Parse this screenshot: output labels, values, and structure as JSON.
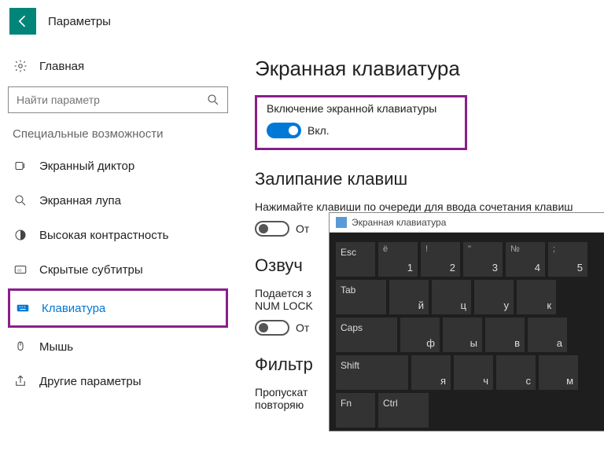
{
  "header": {
    "title": "Параметры"
  },
  "sidebar": {
    "home_label": "Главная",
    "search_placeholder": "Найти параметр",
    "section_header": "Специальные возможности",
    "items": [
      {
        "label": "Экранный диктор",
        "name": "nav-narrator"
      },
      {
        "label": "Экранная лупа",
        "name": "nav-magnifier"
      },
      {
        "label": "Высокая контрастность",
        "name": "nav-high-contrast"
      },
      {
        "label": "Скрытые субтитры",
        "name": "nav-closed-captions"
      },
      {
        "label": "Клавиатура",
        "name": "nav-keyboard"
      },
      {
        "label": "Мышь",
        "name": "nav-mouse"
      },
      {
        "label": "Другие параметры",
        "name": "nav-other-options"
      }
    ]
  },
  "main": {
    "h1": "Экранная клавиатура",
    "osk_setting": {
      "desc": "Включение экранной клавиатуры",
      "state_label": "Вкл."
    },
    "sticky": {
      "h2": "Залипание клавиш",
      "desc": "Нажимайте клавиши по очереди для ввода сочетания клавиш",
      "state_label": "Откл."
    },
    "toggle_snippet": "От",
    "sound": {
      "h2": "Озвучивание переключений",
      "desc": "Подается звуковой сигнал при нажатии клавиш CAPS LOCK, NUM LOCK и SCROLL LOCK"
    },
    "desc_trunc": "Подается з",
    "numlock_trunc": "NUM LOCK",
    "filter": {
      "h2": "Фильтрация ввода",
      "desc1": "Пропускать краткие или повторные нажатия",
      "desc1_trunc1": "Пропускат",
      "desc1_trunc2": "повторяю"
    },
    "sound_h2_trunc": "Озвуч",
    "filter_h2_trunc": "Фильтр"
  },
  "osk": {
    "title": "Экранная клавиатура",
    "rows": [
      [
        {
          "label": "Esc",
          "special": true,
          "w": "kw1"
        },
        {
          "label": "1",
          "sup": "ё",
          "w": "kw1"
        },
        {
          "label": "2",
          "sup": "!",
          "w": "kw1"
        },
        {
          "label": "3",
          "sup": "\"",
          "w": "kw1"
        },
        {
          "label": "4",
          "sup": "№",
          "w": "kw1"
        },
        {
          "label": "5",
          "sup": ";",
          "w": "kw1"
        }
      ],
      [
        {
          "label": "Tab",
          "special": true,
          "w": "kw2"
        },
        {
          "label": "й",
          "w": "kw1"
        },
        {
          "label": "ц",
          "w": "kw1"
        },
        {
          "label": "у",
          "w": "kw1"
        },
        {
          "label": "к",
          "w": "kw1"
        }
      ],
      [
        {
          "label": "Caps",
          "special": true,
          "w": "kw3"
        },
        {
          "label": "ф",
          "w": "kw1"
        },
        {
          "label": "ы",
          "w": "kw1"
        },
        {
          "label": "в",
          "w": "kw1"
        },
        {
          "label": "а",
          "w": "kw1"
        }
      ],
      [
        {
          "label": "Shift",
          "special": true,
          "w": "kw4"
        },
        {
          "label": "я",
          "w": "kw1"
        },
        {
          "label": "ч",
          "w": "kw1"
        },
        {
          "label": "с",
          "w": "kw1"
        },
        {
          "label": "м",
          "w": "kw1"
        }
      ],
      [
        {
          "label": "Fn",
          "special": true,
          "w": "kw1"
        },
        {
          "label": "Ctrl",
          "special": true,
          "w": "kw2"
        }
      ]
    ]
  }
}
